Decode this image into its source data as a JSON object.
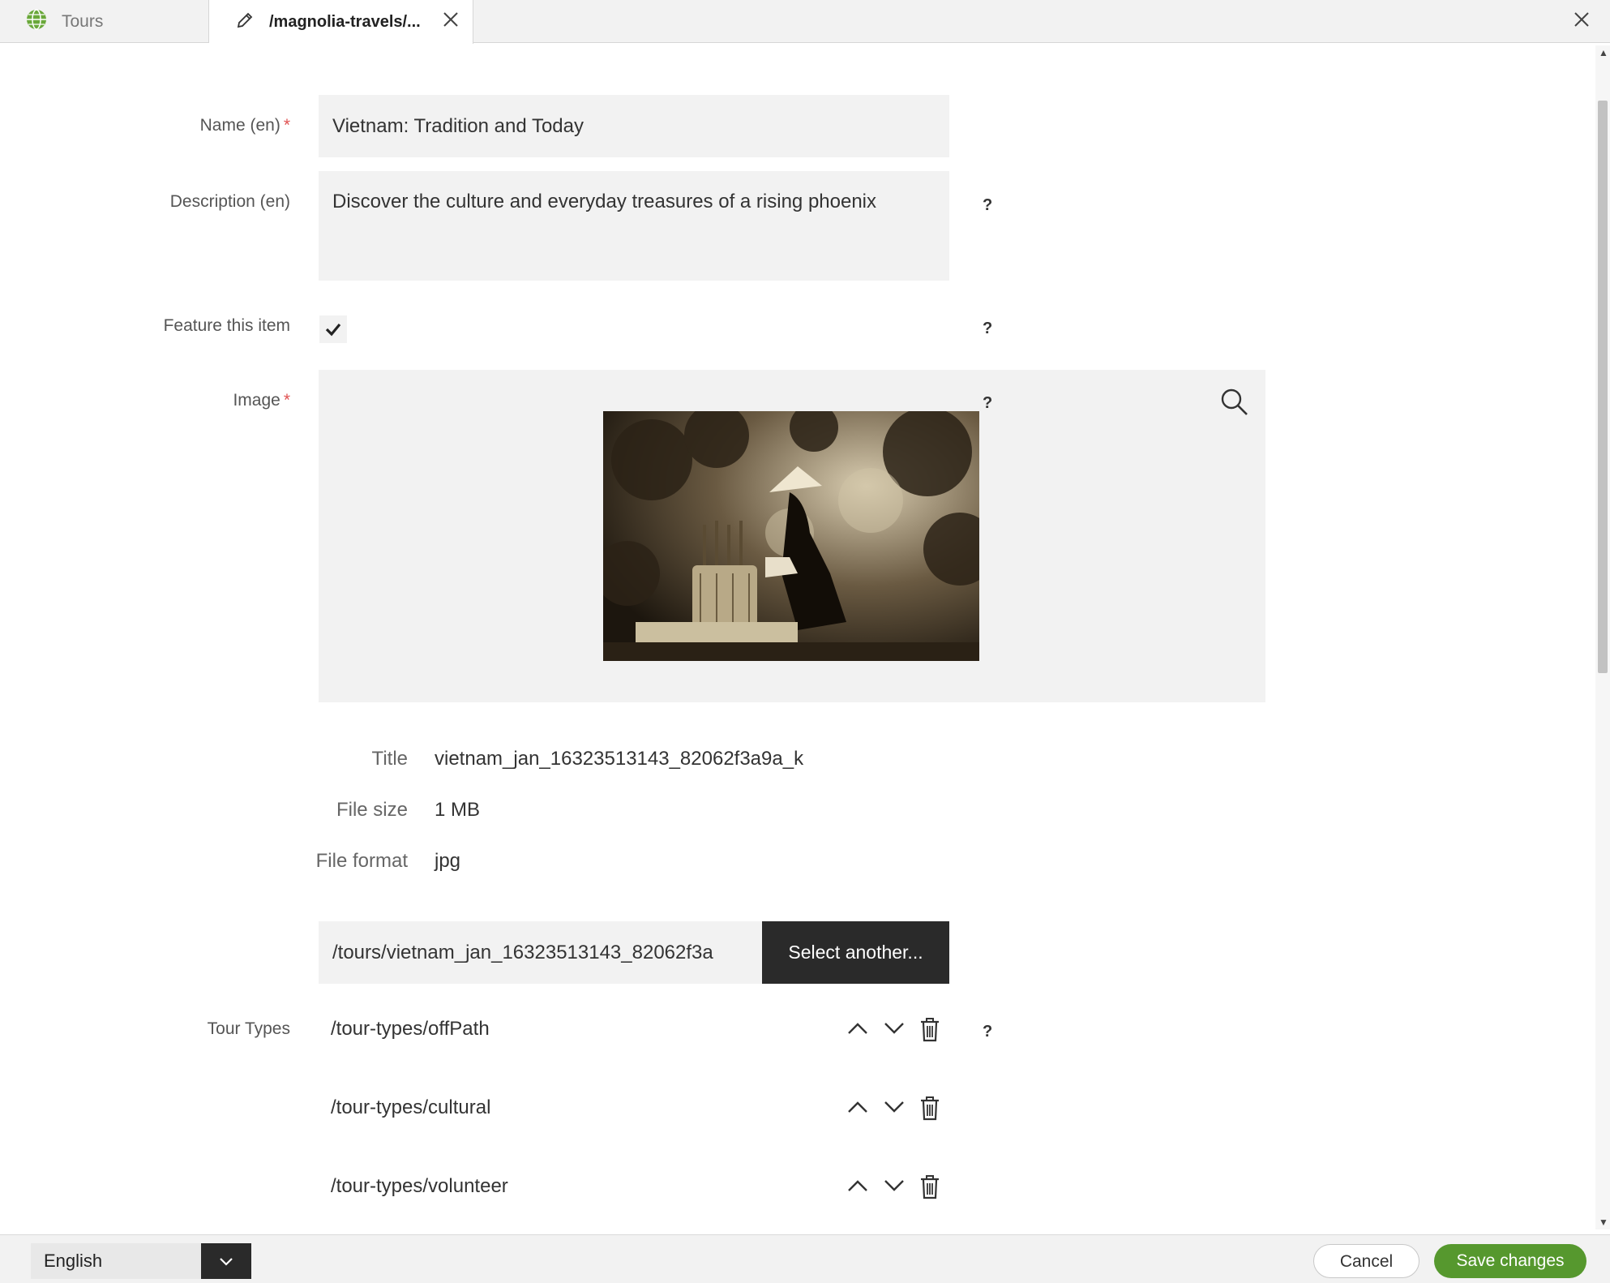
{
  "tabs": {
    "tours_label": "Tours",
    "edit_label": "/magnolia-travels/..."
  },
  "form": {
    "name_label": "Name (en)",
    "name_value": "Vietnam: Tradition and Today",
    "description_label": "Description (en)",
    "description_value": "Discover the culture and everyday treasures of a rising phoenix",
    "feature_label": "Feature this item",
    "feature_checked": true,
    "image_label": "Image",
    "required_mark": "*",
    "help_mark": "?",
    "image_meta": {
      "title_label": "Title",
      "title_value": "vietnam_jan_16323513143_82062f3a9a_k",
      "size_label": "File size",
      "size_value": "1 MB",
      "format_label": "File format",
      "format_value": "jpg"
    },
    "image_path": "/tours/vietnam_jan_16323513143_82062f3a",
    "select_another_label": "Select another...",
    "tour_types_label": "Tour Types",
    "tour_types": [
      "/tour-types/offPath",
      "/tour-types/cultural",
      "/tour-types/volunteer"
    ]
  },
  "footer": {
    "language": "English",
    "cancel_label": "Cancel",
    "save_label": "Save changes"
  },
  "colors": {
    "accent_green": "#56982e",
    "required_red": "#e05252",
    "dark_button": "#2a2a2a"
  }
}
